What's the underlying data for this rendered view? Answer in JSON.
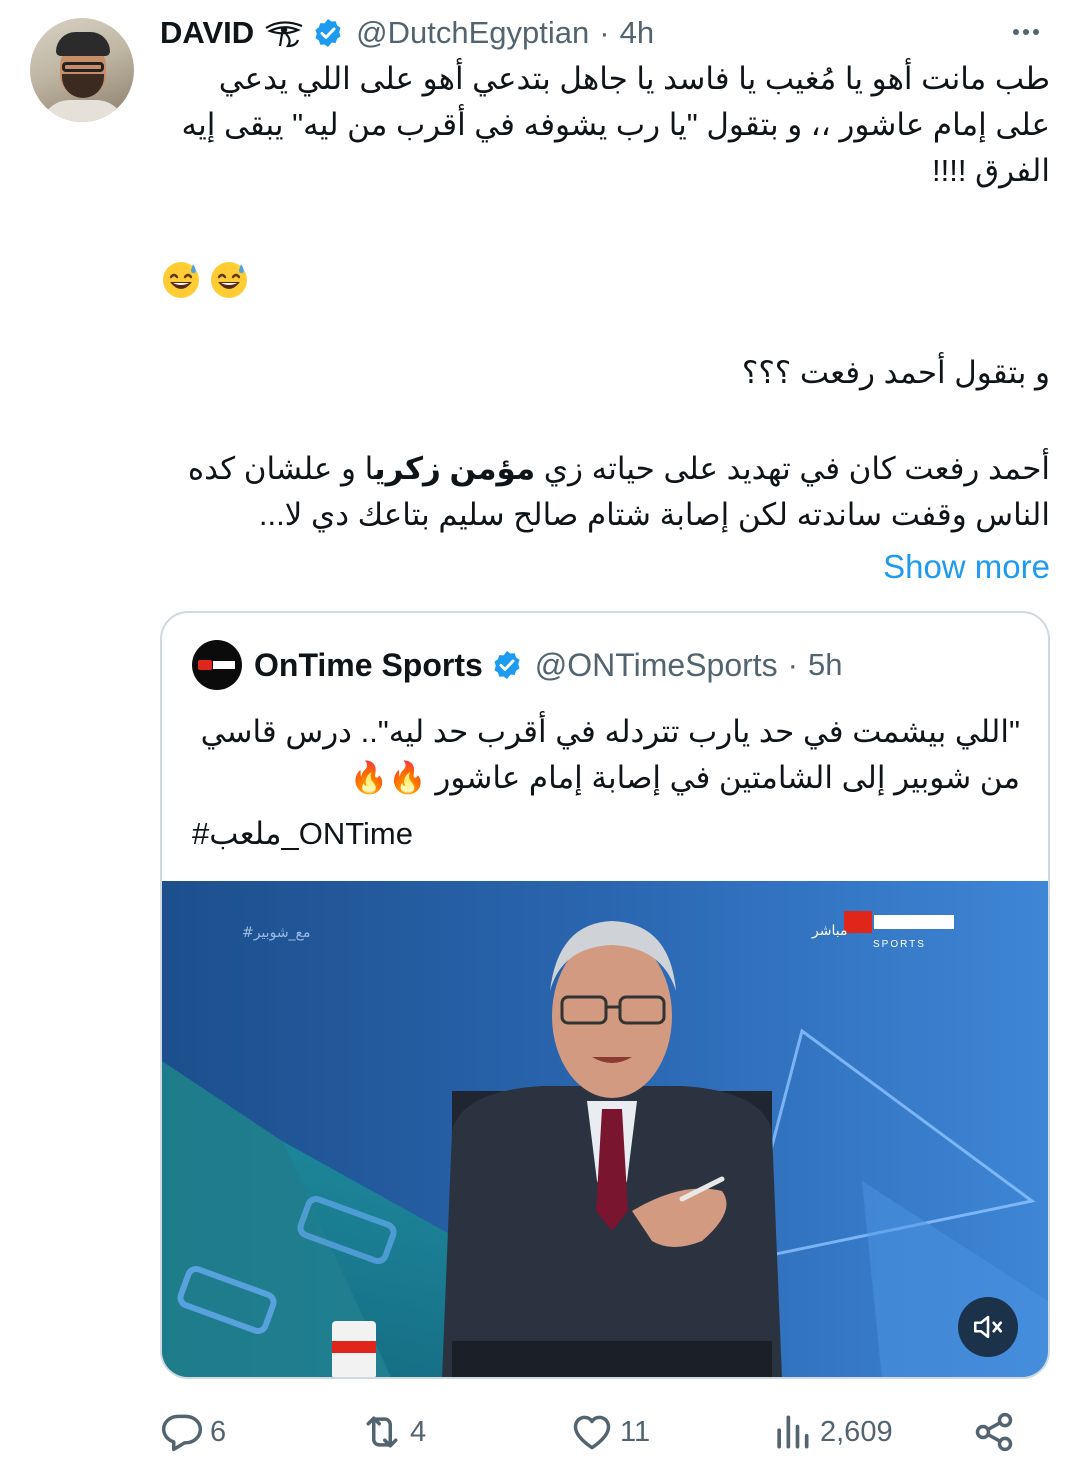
{
  "author": {
    "name": "DAVID",
    "handle": "@DutchEgyptian",
    "separator": "·",
    "time": "4h"
  },
  "tweet": {
    "paragraph1": "طب مانت أهو يا مُغيب يا فاسد يا جاهل بتدعي أهو على اللي يدعي على إمام عاشور ،، و بتقول \"يا رب يشوفه في أقرب من ليه\" يبقى إيه الفرق !!!!",
    "paragraph3": "و بتقول أحمد رفعت ؟؟؟",
    "paragraph4_before_bold": "أحمد رفعت كان في تهديد على حياته زي ",
    "paragraph4_bold": "مؤمن زكري",
    "paragraph4_after_bold": "ا و علشان كده الناس وقفت ساندته لكن إصابة شتام صالح سليم بتاعك دي لا...",
    "show_more": "Show more"
  },
  "quoted": {
    "name": "OnTime Sports",
    "handle": "@ONTimeSports",
    "separator": "·",
    "time": "5h",
    "text": "\"اللي بيشمت في حد يارب تتردله في أقرب حد ليه\".. درس قاسي من شوبير إلى الشامتين في إصابة إمام عاشور 🔥🔥",
    "hashtag": "#ملعب_ONTime",
    "video_overlay_hashtag": "#مع_شوبير",
    "channel_logo": "ON TIME SPORTS",
    "channel_live": "مباشر"
  },
  "actions": {
    "replies": "6",
    "reposts": "4",
    "likes": "11",
    "views": "2,609"
  },
  "colors": {
    "accent": "#1d9bf0",
    "secondary_text": "#536471",
    "border": "#cfd9de"
  },
  "icons": [
    "horus-eye-icon",
    "verified-badge-icon",
    "more-options-icon",
    "sweat-smile-emoji",
    "mute-icon",
    "reply-icon",
    "repost-icon",
    "like-icon",
    "views-icon",
    "share-icon"
  ]
}
